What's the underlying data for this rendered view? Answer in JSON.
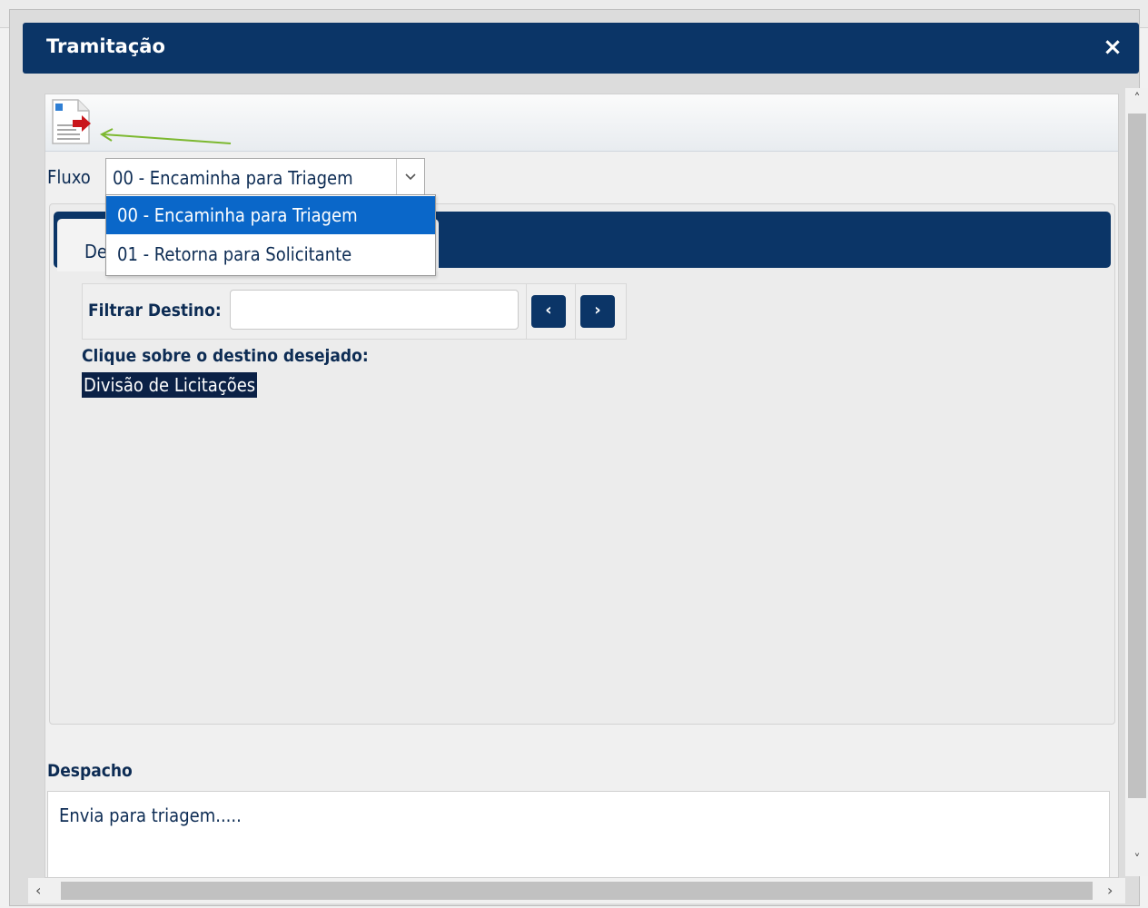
{
  "dialog": {
    "title": "Tramitação",
    "close_glyph": "×"
  },
  "toolbar": {
    "send_icon": "document-forward-icon",
    "hint_arrow_color": "#7cb82f"
  },
  "fluxo": {
    "label": "Fluxo",
    "selected": "00 - Encaminha para Triagem",
    "options": [
      "00 - Encaminha para Triagem",
      "01 - Retorna para Solicitante"
    ]
  },
  "tab": {
    "label": "De"
  },
  "filter": {
    "label": "Filtrar Destino:",
    "value": "",
    "prev_glyph": "‹",
    "next_glyph": "›"
  },
  "destinations": {
    "hint": "Clique sobre o destino desejado:",
    "items": [
      "Divisão de Licitações"
    ]
  },
  "despacho": {
    "label": "Despacho",
    "text": "Envia para triagem....."
  },
  "scroll": {
    "up": "˄",
    "down": "˅",
    "left": "‹",
    "right": "›"
  },
  "colors": {
    "primary": "#0b3567",
    "selection": "#0a67c9"
  }
}
